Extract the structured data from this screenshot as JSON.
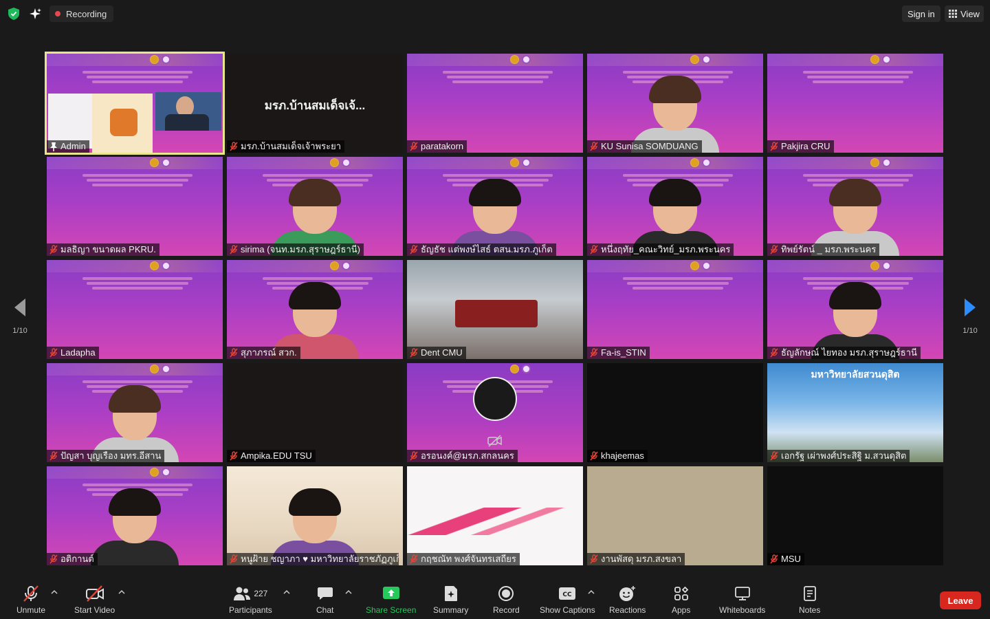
{
  "topbar": {
    "recording_label": "Recording",
    "sign_in_label": "Sign in",
    "view_label": "View"
  },
  "pagination": {
    "left": "1/10",
    "right": "1/10"
  },
  "participants": [
    {
      "name": "Admin",
      "active": true,
      "video": "screen-share"
    },
    {
      "name": "มรภ.บ้านสมเด็จเจ้าพระยา",
      "tile_title": "มรภ.บ้านสมเด็จเจ้...",
      "video": "off"
    },
    {
      "name": "paratakorn",
      "video": "slide"
    },
    {
      "name": "KU Sunisa SOMDUANG",
      "video": "person"
    },
    {
      "name": "Pakjira CRU",
      "video": "slide"
    },
    {
      "name": "มลธิญา ขนาดผล PKRU.",
      "video": "slide"
    },
    {
      "name": "sirima (จนท.มรภ.สุราษฎร์ธานี)",
      "video": "person"
    },
    {
      "name": "ธัญธัช แต่พงษ์ไสธ์ ตสน.มรภ.ภูเก็ต",
      "video": "person"
    },
    {
      "name": "หนึ่งฤทัย_คณะวิทย์_มรภ.พระนคร",
      "video": "person"
    },
    {
      "name": "ทิพย์รัตน์ _ มรภ.พระนคร",
      "video": "person"
    },
    {
      "name": "Ladapha",
      "video": "slide"
    },
    {
      "name": "สุภาภรณ์ สวก.",
      "video": "person"
    },
    {
      "name": "Dent CMU",
      "video": "room"
    },
    {
      "name": "Fa-is_STIN",
      "video": "slide"
    },
    {
      "name": "ธัญลักษณ์ ไยทอง มรภ.สุราษฎร์ธานี",
      "video": "person"
    },
    {
      "name": "ปัญสา บุญเรือง มทร.อีสาน",
      "video": "person"
    },
    {
      "name": "Ampika.EDU TSU",
      "video": "dark"
    },
    {
      "name": "อรอนงค์@มรภ.สกลนคร",
      "video": "obs"
    },
    {
      "name": "khajeemas",
      "video": "black"
    },
    {
      "name": "เอกรัฐ เผ่าพงศ์ประสิฐิ ม.สวนดุสิต",
      "video": "campus",
      "banner": "มหาวิทยาลัยสวนดุสิต"
    },
    {
      "name": "อติกานต์",
      "video": "person"
    },
    {
      "name": "หนูฝ้าย ชญาภา ♥ มหาวิทยาลัยราชภัฏภูเก็ต",
      "video": "blur"
    },
    {
      "name": "กฤชณัท พงศ์จันทรเสถียร",
      "video": "white"
    },
    {
      "name": "งานพัสดุ มรภ.สงขลา",
      "video": "beige"
    },
    {
      "name": "MSU",
      "video": "black"
    }
  ],
  "toolbar": {
    "unmute": "Unmute",
    "start_video": "Start Video",
    "participants": "Participants",
    "participant_count": "227",
    "chat": "Chat",
    "share_screen": "Share Screen",
    "summary": "Summary",
    "record": "Record",
    "show_captions": "Show Captions",
    "reactions": "Reactions",
    "apps": "Apps",
    "whiteboards": "Whiteboards",
    "notes": "Notes",
    "leave": "Leave"
  },
  "colors": {
    "background": "#1a1a1a",
    "share_green": "#26c95b",
    "leave_red": "#d8271e",
    "recording_red": "#e5484d",
    "active_speaker": "#e9e58a",
    "muted_red": "#e0463a"
  }
}
